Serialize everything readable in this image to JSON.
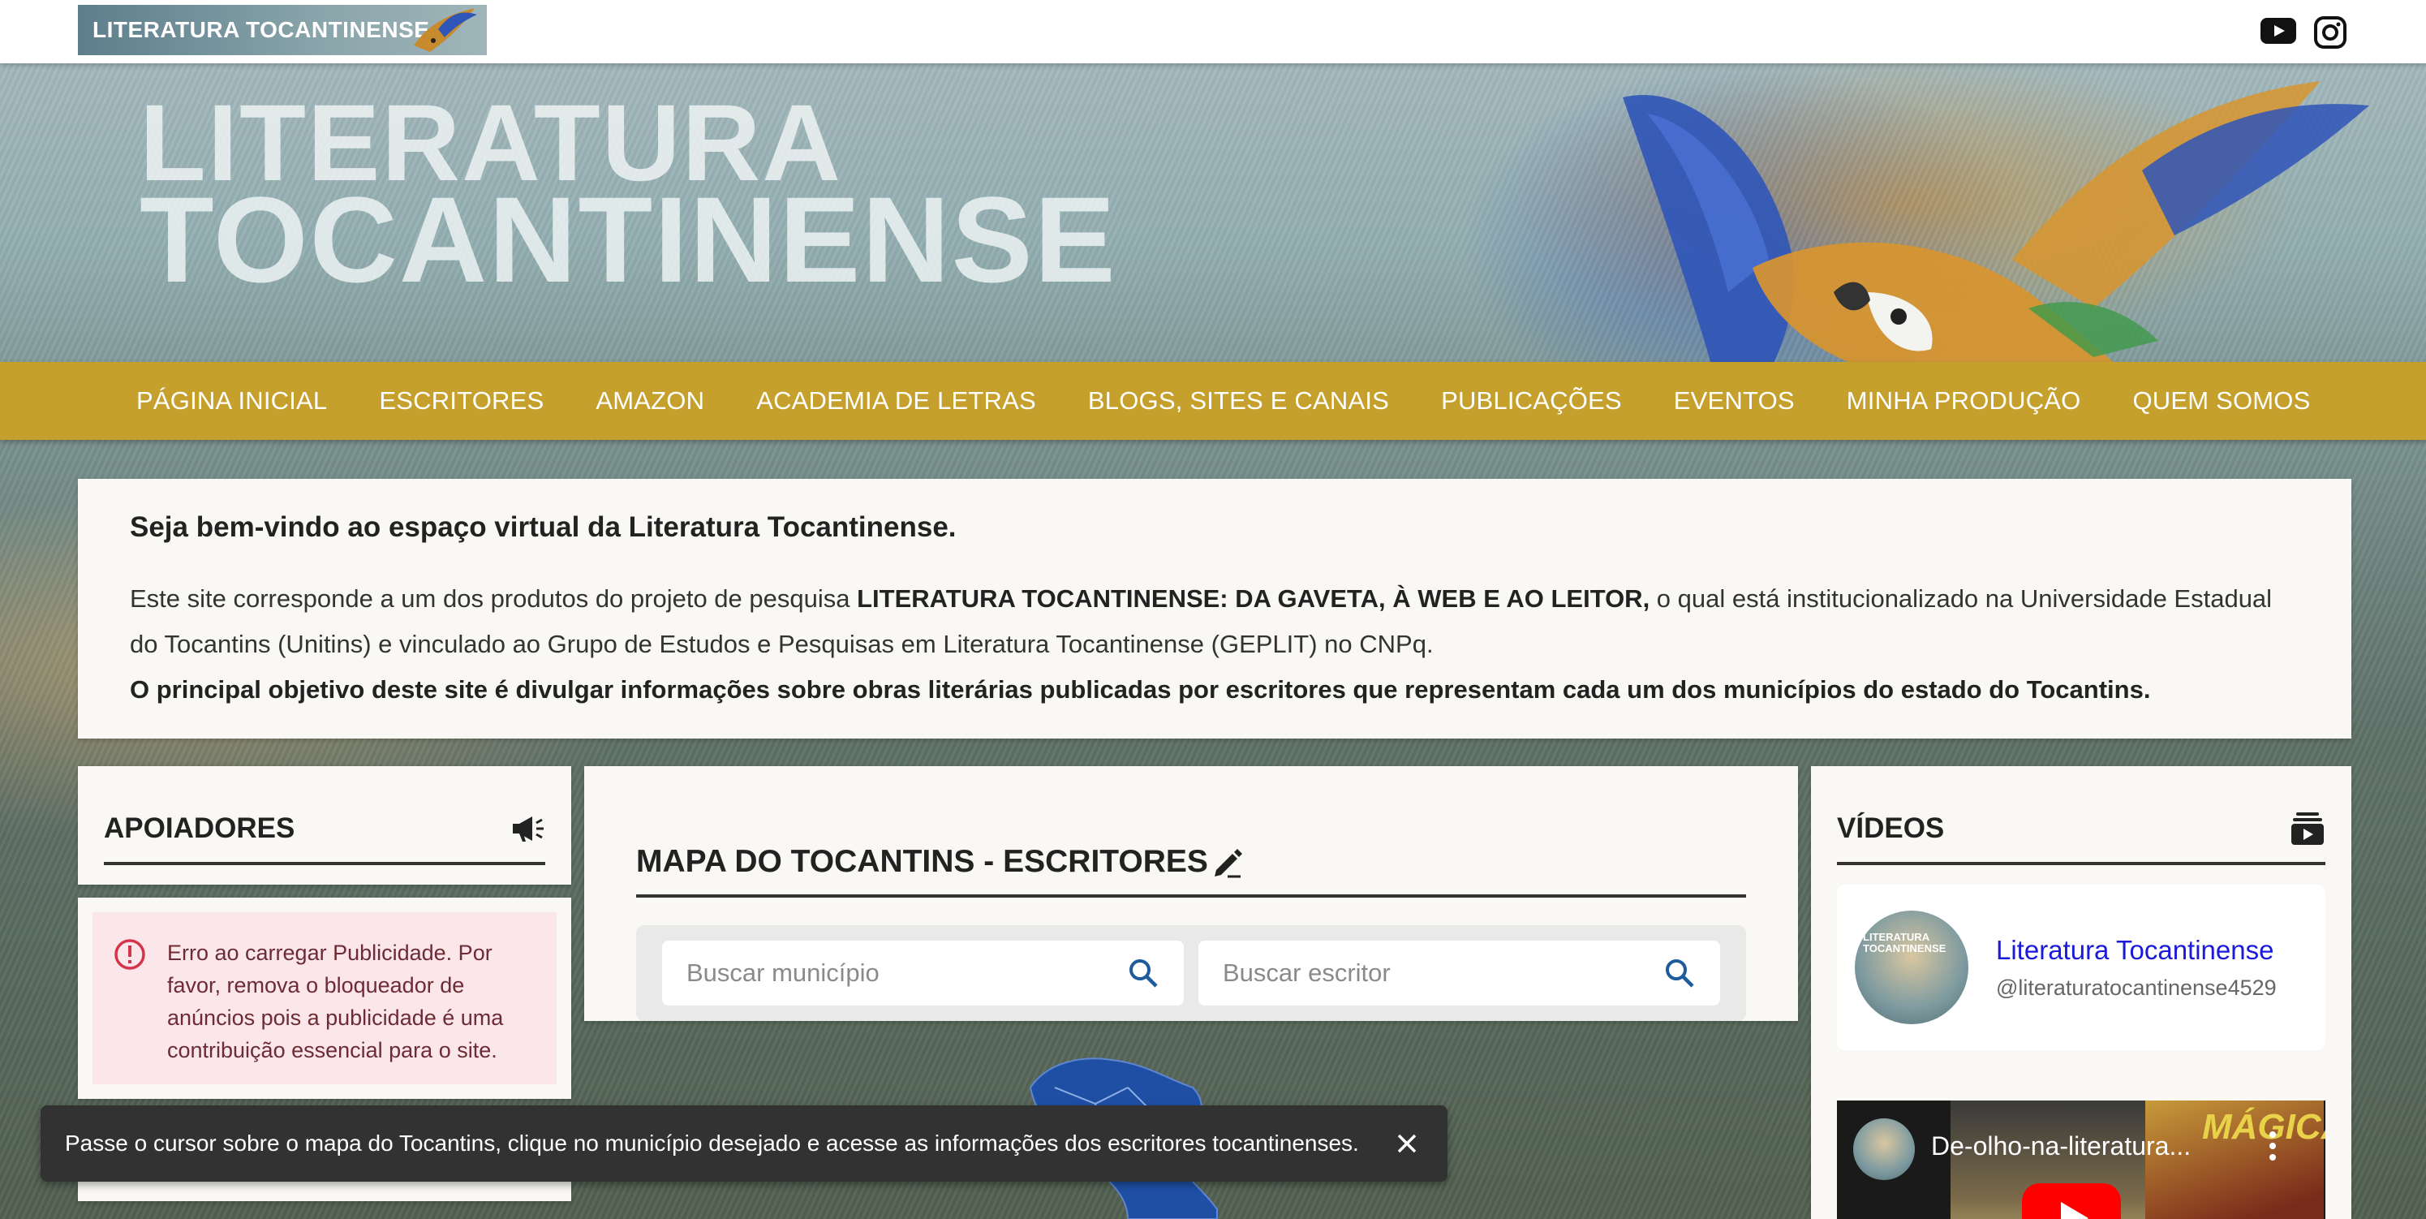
{
  "header": {
    "logo_text": "LITERATURA TOCANTINENSE",
    "social": [
      {
        "name": "youtube-icon"
      },
      {
        "name": "instagram-icon"
      }
    ]
  },
  "hero": {
    "title_line1": "LITERATURA",
    "title_line2": "TOCANTINENSE"
  },
  "nav": {
    "items": [
      {
        "label": "PÁGINA INICIAL"
      },
      {
        "label": "ESCRITORES"
      },
      {
        "label": "AMAZON"
      },
      {
        "label": "ACADEMIA DE LETRAS"
      },
      {
        "label": "BLOGS, SITES E CANAIS"
      },
      {
        "label": "PUBLICAÇÕES"
      },
      {
        "label": "EVENTOS"
      },
      {
        "label": "MINHA PRODUÇÃO"
      },
      {
        "label": "QUEM SOMOS"
      }
    ]
  },
  "welcome": {
    "title": "Seja bem-vindo ao espaço virtual da Literatura Tocantinense.",
    "p1_before": "Este site corresponde a um dos produtos do projeto de pesquisa ",
    "p1_strong": "LITERATURA TOCANTINENSE: DA GAVETA, À WEB E AO LEITOR,",
    "p1_after": " o qual está institucionalizado na Universidade Estadual do Tocantins (Unitins) e vinculado ao Grupo de Estudos e Pesquisas em Literatura Tocantinense (GEPLIT) no CNPq.",
    "p2": "O principal objetivo deste site é divulgar informações sobre obras literárias publicadas por escritores que representam cada um dos municípios do estado do Tocantins."
  },
  "apoiadores": {
    "title": "APOIADORES",
    "error": "Erro ao carregar Publicidade. Por favor, remova o bloqueador de anúncios pois a publicidade é uma contribuição essencial para o site."
  },
  "mapa": {
    "title": "MAPA DO TOCANTINS - ESCRITORES",
    "search_municipio_placeholder": "Buscar município",
    "search_escritor_placeholder": "Buscar escritor"
  },
  "videos": {
    "title": "VÍDEOS",
    "channel_name": "Literatura Tocantinense",
    "channel_handle": "@literaturatocantinense4529",
    "avatar_text": "LITERATURA TOCANTINENSE",
    "video_title": "De-olho-na-literatura...",
    "thumb_text": "MÁGICA",
    "play_icon": "play-icon"
  },
  "toast": {
    "message": "Passe o cursor sobre o mapa do Tocantins, clique no município desejado e acesse as informações dos escritores tocantinenses."
  },
  "colors": {
    "nav_bg": "#c6a02c",
    "panel_bg": "#f9f8f4",
    "error_bg": "#fbe6ea",
    "error_icon": "#d3364a",
    "link": "#1a1ad8",
    "toast_bg": "#323232",
    "search_icon": "#1e5a9c",
    "map_fill": "#1f4fa5"
  }
}
